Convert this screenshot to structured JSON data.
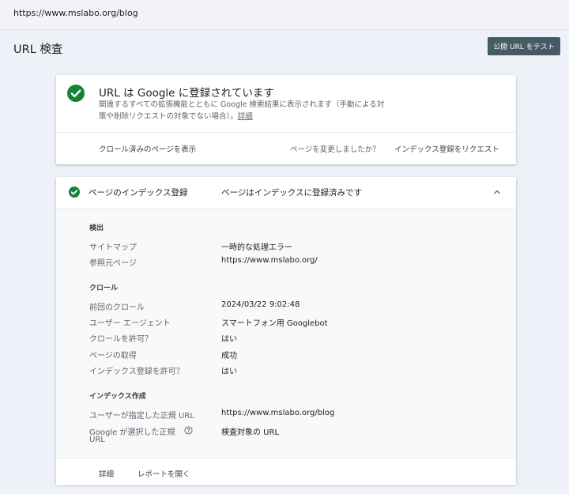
{
  "address_bar": {
    "url": "https://www.mslabo.org/blog"
  },
  "header": {
    "title": "URL 検査",
    "test_button": "公開 URL をテスト"
  },
  "status_card": {
    "headline_prefix": "URL は ",
    "headline_brand": "Google",
    "headline_suffix": " に登録されています",
    "description": "関連するすべての拡張機能とともに Google 検索結果に表示されます（手動による対策や削除リクエストの対象でない場合）。",
    "details_link": "詳細",
    "view_crawled": "クロール済みのページを表示",
    "changed_question": "ページを変更しましたか？",
    "request_indexing": "インデックス登録をリクエスト",
    "accent_color": "#188038"
  },
  "index_card": {
    "title": "ページのインデックス登録",
    "status": "ページはインデックスに登録済みです",
    "sections": [
      {
        "title": "検出",
        "rows": [
          {
            "label": "サイトマップ",
            "value": "一時的な処理エラー"
          },
          {
            "label": "参照元ページ",
            "value": "https://www.mslabo.org/"
          }
        ]
      },
      {
        "title": "クロール",
        "rows": [
          {
            "label": "前回のクロール",
            "value": "2024/03/22 9:02:48"
          },
          {
            "label": "ユーザー エージェント",
            "value": "スマートフォン用 Googlebot"
          },
          {
            "label": "クロールを許可？",
            "value": "はい"
          },
          {
            "label": "ページの取得",
            "value": "成功"
          },
          {
            "label": "インデックス登録を許可？",
            "value": "はい"
          }
        ]
      },
      {
        "title": "インデックス作成",
        "rows": [
          {
            "label": "ユーザーが指定した正規 URL",
            "value": "https://www.mslabo.org/blog"
          },
          {
            "label_line1": "Google が選択した正規",
            "label_line2": "URL",
            "value": "検査対象の URL",
            "icon": "help-icon"
          }
        ]
      }
    ],
    "footer": {
      "details": "詳細",
      "open_report": "レポートを開く"
    }
  }
}
